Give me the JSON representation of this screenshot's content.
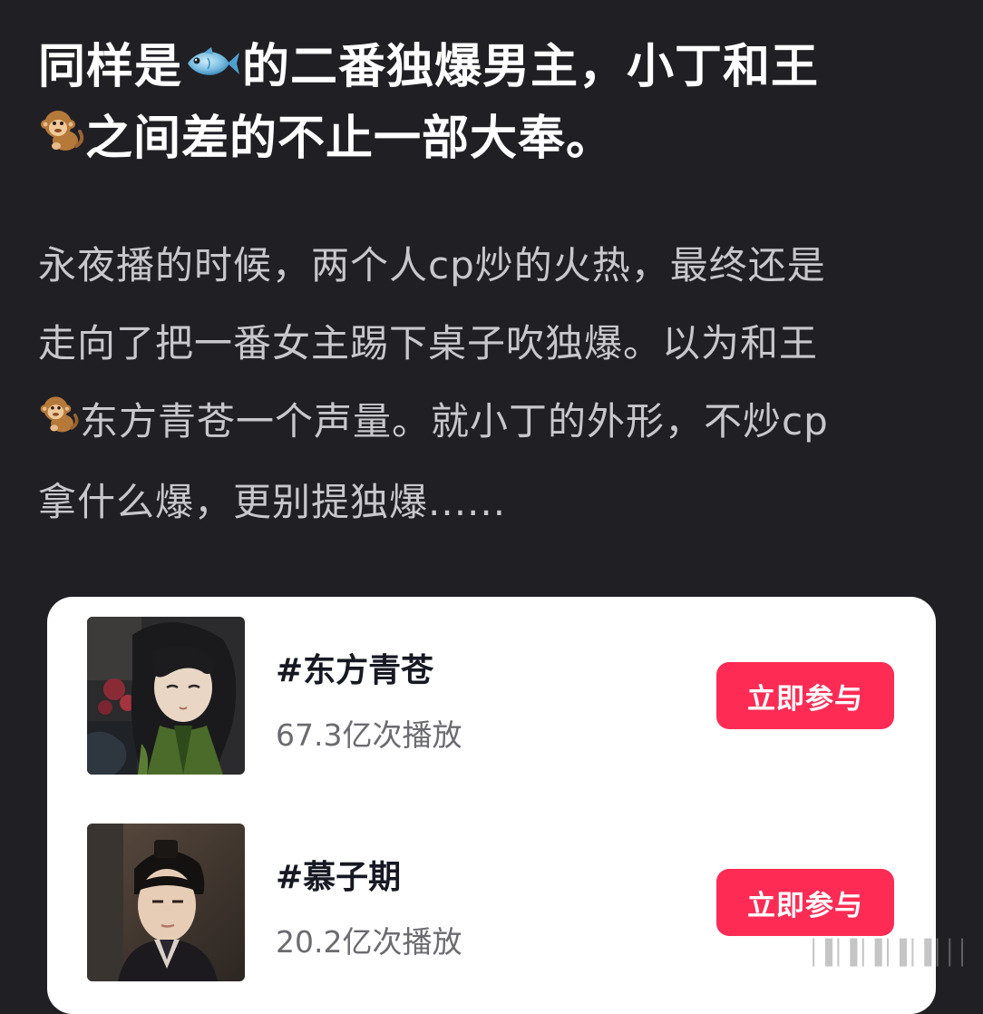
{
  "post": {
    "title_part1": "同样是",
    "title_part2": "的二番独爆男主，小丁和王",
    "title_part3": "之间差的不止一部大奉。",
    "body_line1": "永夜播的时候，两个人cp炒的火热，最终还是",
    "body_line2": "走向了把一番女主踢下桌子吹独爆。以为和王",
    "body_line3": "东方青苍一个声量。就小丁的外形，不炒cp",
    "body_line4": "拿什么爆，更别提独爆......",
    "emoji_fish": "fish-icon",
    "emoji_monkey": "monkey-icon"
  },
  "topics": [
    {
      "name": "#东方青苍",
      "plays": "67.3亿次播放",
      "button_label": "立即参与",
      "thumbnail": "anime-character-avatar"
    },
    {
      "name": "#慕子期",
      "plays": "20.2亿次播放",
      "button_label": "立即参与",
      "thumbnail": "actor-portrait-avatar"
    }
  ],
  "colors": {
    "background": "#202024",
    "title": "#ffffff",
    "body": "#c7c7cc",
    "button": "#fe2c55",
    "card": "#ffffff"
  }
}
